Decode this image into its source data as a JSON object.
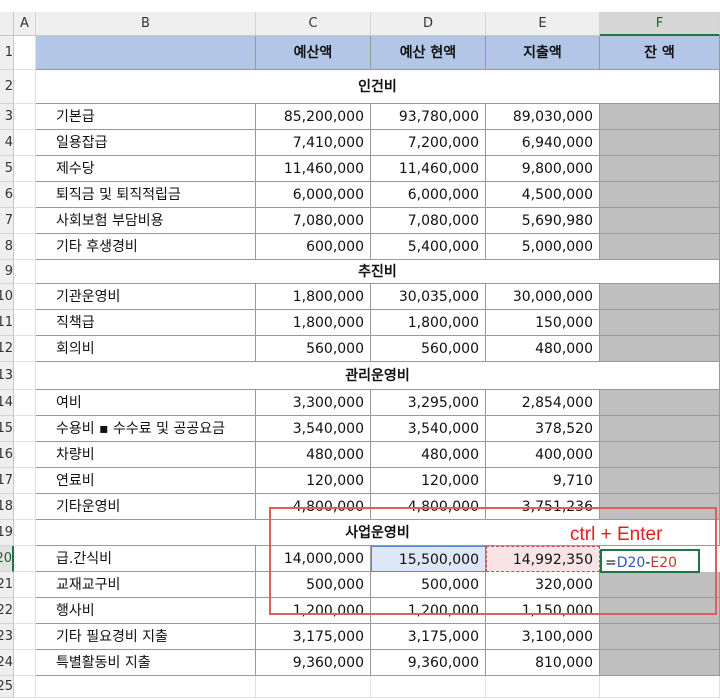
{
  "columns": [
    {
      "id": "A",
      "label": "A"
    },
    {
      "id": "B",
      "label": "B"
    },
    {
      "id": "C",
      "label": "C"
    },
    {
      "id": "D",
      "label": "D"
    },
    {
      "id": "E",
      "label": "E"
    },
    {
      "id": "F",
      "label": "F"
    }
  ],
  "header": {
    "budget": "예산액",
    "current": "예산 현액",
    "spent": "지출액",
    "balance": "잔 액"
  },
  "rows": [
    {
      "num": "2",
      "type": "section",
      "title": "인건비"
    },
    {
      "num": "3",
      "type": "item",
      "name": "기본급",
      "budget": "85,200,000",
      "current": "93,780,000",
      "spent": "89,030,000"
    },
    {
      "num": "4",
      "type": "item",
      "name": "일용잡급",
      "budget": "7,410,000",
      "current": "7,200,000",
      "spent": "6,940,000"
    },
    {
      "num": "5",
      "type": "item",
      "name": "제수당",
      "budget": "11,460,000",
      "current": "11,460,000",
      "spent": "9,800,000"
    },
    {
      "num": "6",
      "type": "item",
      "name": "퇴직금 및 퇴직적립금",
      "budget": "6,000,000",
      "current": "6,000,000",
      "spent": "4,500,000"
    },
    {
      "num": "7",
      "type": "item",
      "name": "사회보험 부담비용",
      "budget": "7,080,000",
      "current": "7,080,000",
      "spent": "5,690,980"
    },
    {
      "num": "8",
      "type": "item",
      "name": "기타 후생경비",
      "budget": "600,000",
      "current": "5,400,000",
      "spent": "5,000,000"
    },
    {
      "num": "9",
      "type": "section",
      "title": "추진비"
    },
    {
      "num": "10",
      "type": "item",
      "name": "기관운영비",
      "budget": "1,800,000",
      "current": "30,035,000",
      "spent": "30,000,000"
    },
    {
      "num": "11",
      "type": "item",
      "name": "직책급",
      "budget": "1,800,000",
      "current": "1,800,000",
      "spent": "150,000"
    },
    {
      "num": "12",
      "type": "item",
      "name": "회의비",
      "budget": "560,000",
      "current": "560,000",
      "spent": "480,000"
    },
    {
      "num": "13",
      "type": "section",
      "title": "관리운영비"
    },
    {
      "num": "14",
      "type": "item",
      "name": "여비",
      "budget": "3,300,000",
      "current": "3,295,000",
      "spent": "2,854,000"
    },
    {
      "num": "15",
      "type": "item",
      "name": "수용비 ▪ 수수료  및 공공요금",
      "budget": "3,540,000",
      "current": "3,540,000",
      "spent": "378,520"
    },
    {
      "num": "16",
      "type": "item",
      "name": "차량비",
      "budget": "480,000",
      "current": "480,000",
      "spent": "400,000"
    },
    {
      "num": "17",
      "type": "item",
      "name": "연료비",
      "budget": "120,000",
      "current": "120,000",
      "spent": "9,710"
    },
    {
      "num": "18",
      "type": "item",
      "name": "기타운영비",
      "budget": "4,800,000",
      "current": "4,800,000",
      "spent": "3,751,236"
    },
    {
      "num": "19",
      "type": "section",
      "title": "사업운영비"
    },
    {
      "num": "20",
      "type": "item",
      "name": "급.간식비",
      "budget": "14,000,000",
      "current": "15,500,000",
      "spent": "14,992,350"
    },
    {
      "num": "21",
      "type": "item",
      "name": "교재교구비",
      "budget": "500,000",
      "current": "500,000",
      "spent": "320,000"
    },
    {
      "num": "22",
      "type": "item",
      "name": "행사비",
      "budget": "1,200,000",
      "current": "1,200,000",
      "spent": "1,150,000"
    },
    {
      "num": "23",
      "type": "item",
      "name": "기타 필요경비 지출",
      "budget": "3,175,000",
      "current": "3,175,000",
      "spent": "3,100,000"
    },
    {
      "num": "24",
      "type": "item",
      "name": "특별활동비 지출",
      "budget": "9,360,000",
      "current": "9,360,000",
      "spent": "810,000"
    },
    {
      "num": "25",
      "type": "blank"
    }
  ],
  "header_row_num": "1",
  "formula": {
    "eq": "=",
    "ref1": "D20",
    "minus": "-",
    "ref2": "E20"
  },
  "annotation": "ctrl + Enter",
  "colors": {
    "header_fill": "#b4c6e7",
    "balance_fill": "#bfbfbf",
    "highlight": "#e35d5d",
    "d20_fill": "#dde7f5",
    "e20_fill": "#f8e4e4"
  }
}
